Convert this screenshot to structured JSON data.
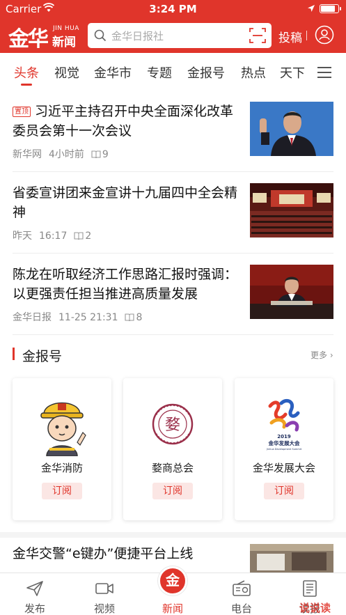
{
  "status_bar": {
    "carrier": "Carrier",
    "time": "3:24 PM",
    "battery_level": 0.9
  },
  "header": {
    "logo_main": "金华",
    "logo_en": "JIN HUA",
    "logo_cn": "新闻",
    "search_placeholder": "金华日报社",
    "submit_label": "投稿",
    "brand_color": "#e0352b"
  },
  "tabs": [
    "头条",
    "视觉",
    "金华市",
    "专题",
    "金报号",
    "热点",
    "天下"
  ],
  "active_tab": 0,
  "news": [
    {
      "pinned_label": "置顶",
      "title": "习近平主持召开中央全面深化改革委员会第十一次会议",
      "source": "新华网",
      "time": "4小时前",
      "reads": "9"
    },
    {
      "title": "省委宣讲团来金宣讲十九届四中全会精神",
      "source": "昨天",
      "time": "16:17",
      "reads": "2"
    },
    {
      "title": "陈龙在听取经济工作思路汇报时强调：以更强责任担当推进高质量发展",
      "source": "金华日报",
      "time": "11-25  21:31",
      "reads": "8"
    }
  ],
  "section": {
    "title": "金报号",
    "more_label": "更多"
  },
  "cards": [
    {
      "name": "金华消防",
      "subscribe": "订阅",
      "logo_icon": "firefighter-mascot"
    },
    {
      "name": "婺商总会",
      "subscribe": "订阅",
      "logo_icon": "chamber-seal",
      "logo_text": "婺"
    },
    {
      "name": "金华发展大会",
      "subscribe": "订阅",
      "logo_icon": "development-conference-logo",
      "logo_year": "2019",
      "logo_cn": "金华发展大会",
      "logo_en": "Jinhua Development Summit"
    }
  ],
  "bottom_news": {
    "title": "金华交警“e键办”便捷平台上线"
  },
  "bottom_nav": [
    {
      "label": "发布",
      "icon": "paper-plane-icon"
    },
    {
      "label": "视频",
      "icon": "video-camera-icon"
    },
    {
      "label": "新闻",
      "icon": "news-logo-icon",
      "center_glyph": "金"
    },
    {
      "label": "电台",
      "icon": "radio-icon"
    },
    {
      "label": "读报",
      "icon": "newspaper-icon"
    }
  ],
  "active_nav": 2,
  "watermark": "说说读"
}
